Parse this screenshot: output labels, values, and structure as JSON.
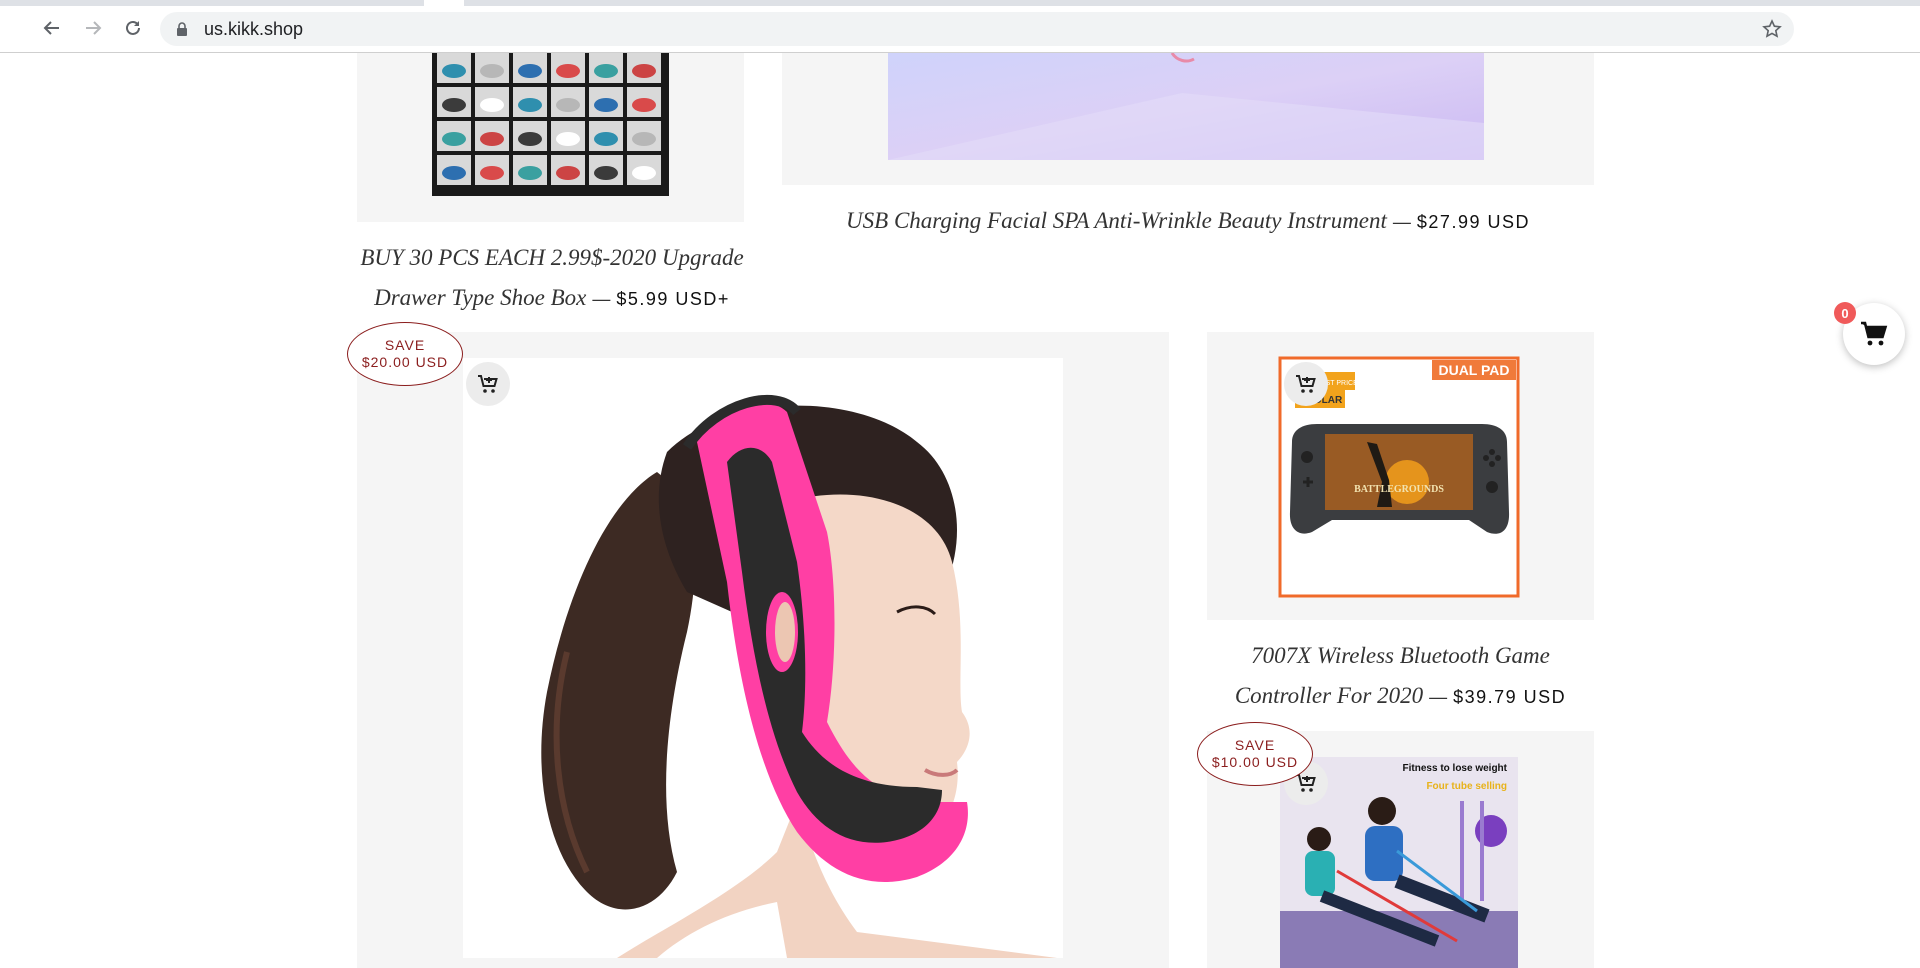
{
  "browser": {
    "url": "us.kikk.shop",
    "icons": {
      "back": "arrow-left-icon",
      "forward": "arrow-right-icon",
      "reload": "reload-icon",
      "lock": "lock-icon",
      "bookmark": "star-icon"
    }
  },
  "products": [
    {
      "id": "shoe-box",
      "title": "BUY 30 PCS EACH 2.99$-2020 Upgrade Drawer Type Shoe Box",
      "price": "$5.99 USD+"
    },
    {
      "id": "facial-spa",
      "title": "USB Charging Facial SPA Anti-Wrinkle Beauty Instrument",
      "price": "$27.99 USD"
    },
    {
      "id": "face-slimming-strap",
      "save_line1": "SAVE",
      "save_line2": "$20.00 USD"
    },
    {
      "id": "game-controller",
      "title": "7007X Wireless Bluetooth Game Controller For 2020",
      "price": "$39.79 USD",
      "image_banner": "DUAL PAD",
      "image_tag": "BEST PRICE",
      "image_tag2": "PULAR",
      "image_game_title": "BATTLEGROUNDS"
    },
    {
      "id": "pedal-exerciser",
      "save_line1": "SAVE",
      "save_line2": "$10.00 USD",
      "image_caption1": "Fitness to lose weight",
      "image_caption2": "Four tube selling"
    }
  ],
  "cart": {
    "count": "0",
    "icon": "cart-icon"
  },
  "separator": "—",
  "colors": {
    "badge": "#8b1e1e",
    "cart_count": "#f05a5a",
    "tile_bg": "#f5f5f5",
    "strap_pink": "#ff3fa4"
  }
}
